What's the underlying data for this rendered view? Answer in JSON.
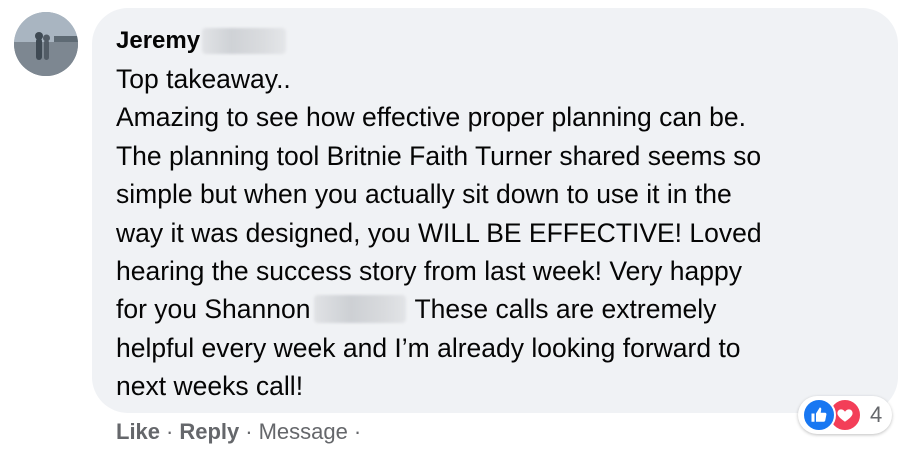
{
  "comment": {
    "author": "Jeremy",
    "lines": [
      "Top takeaway..",
      "Amazing to see how effective proper planning can be.",
      "The planning tool Britnie Faith Turner shared seems so",
      "simple but when you actually sit down to use it in the",
      "way it was designed, you WILL BE EFFECTIVE! Loved",
      "hearing the success story from last week! Very happy",
      "helpful every week and I’m already looking forward to",
      "next weeks call!"
    ],
    "line_with_mention": {
      "before": "for you Shannon",
      "after": "These calls are extremely"
    }
  },
  "reactions": {
    "icons": [
      "like-icon",
      "love-icon"
    ],
    "count": "4",
    "colors": {
      "like": "#1877f2",
      "love": "#f33e58"
    }
  },
  "actions": {
    "like": "Like",
    "reply": "Reply",
    "message": "Message",
    "separator": "·"
  },
  "colors": {
    "bubble": "#f0f2f5",
    "text": "#050505",
    "muted": "#65676b"
  }
}
